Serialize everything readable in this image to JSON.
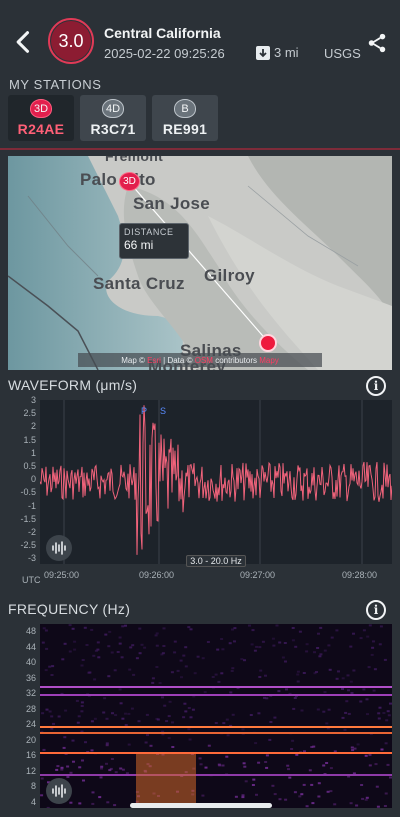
{
  "header": {
    "magnitude": "3.0",
    "title": "Central California",
    "datetime": "2025-02-22 09:25:26",
    "distance": "3 mi",
    "source": "USGS"
  },
  "stations": {
    "label": "MY STATIONS",
    "items": [
      {
        "type": "3D",
        "code": "R24AE",
        "active": true
      },
      {
        "type": "4D",
        "code": "R3C71",
        "active": false
      },
      {
        "type": "B",
        "code": "RE991",
        "active": false
      }
    ]
  },
  "map": {
    "places": [
      "Fremont",
      "Palo Alto",
      "San Jose",
      "Santa Cruz",
      "Gilroy",
      "Salinas",
      "Monterey"
    ],
    "distance_label": "DISTANCE",
    "distance_value": "66 mi",
    "pin_label": "3D",
    "attribution": {
      "prefix": "Map ©",
      "source1": "Esri",
      "mid": "| Data ©",
      "source2": "OSM",
      "suffix": "contributors",
      "tail": "Mapy"
    }
  },
  "waveform": {
    "title": "WAVEFORM (μm/s)",
    "y_ticks": [
      "3",
      "2.5",
      "2",
      "1.5",
      "1",
      "0.5",
      "0",
      "-0.5",
      "-1",
      "-1.5",
      "-2",
      "-2.5",
      "-3"
    ],
    "x_ticks": [
      "09:25:00",
      "09:26:00",
      "09:27:00",
      "09:28:00"
    ],
    "timezone": "UTC",
    "filter": "3.0 - 20.0 Hz",
    "phase_labels": [
      "P",
      "S"
    ]
  },
  "frequency": {
    "title": "FREQUENCY (Hz)",
    "y_ticks": [
      "48",
      "44",
      "40",
      "36",
      "32",
      "28",
      "24",
      "20",
      "16",
      "12",
      "8",
      "4"
    ]
  },
  "colors": {
    "accent": "#e21f4d",
    "waveform": "#f0637b",
    "background": "#2b3137"
  }
}
